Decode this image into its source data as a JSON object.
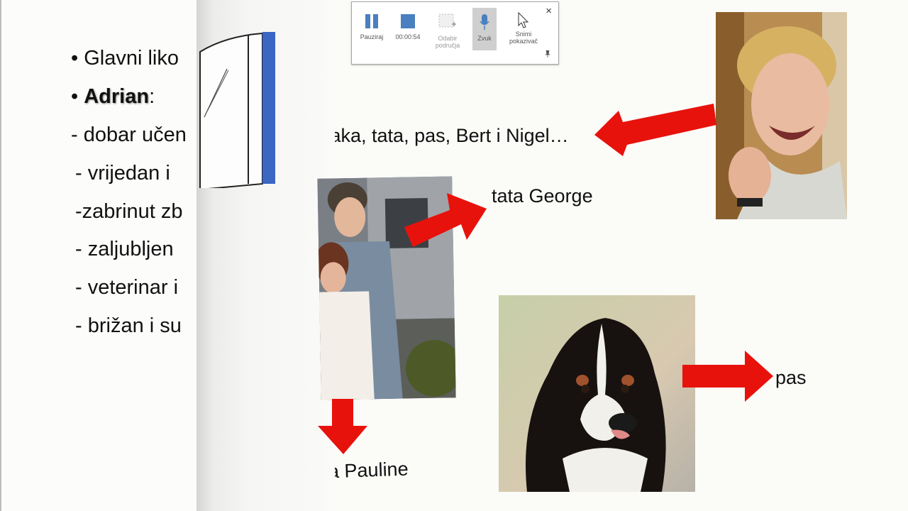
{
  "slide": {
    "bullets": [
      {
        "text": "• Glavni liko"
      },
      {
        "text": "•",
        "bold": "Adrian",
        "suffix": ":"
      },
      {
        "text": "-  dobar učen"
      },
      {
        "text": " - vrijedan i "
      },
      {
        "text": " -zabrinut zb"
      },
      {
        "text": " - zaljubljen "
      },
      {
        "text": " - veterinar i"
      },
      {
        "text": " - brižan i su"
      }
    ],
    "family_text": "ɔaka, tata, pas, Bert i Nigel…",
    "tata_label": "tata George",
    "pauline_label": "na Pauline",
    "pas_label": "pas",
    "arrow_color": "#e8120c"
  },
  "recorder": {
    "buttons": [
      {
        "label": "Pauziraj",
        "icon": "pause-icon"
      },
      {
        "label": "00:00:54",
        "icon": "stop-icon"
      },
      {
        "label": "Odabir područja",
        "icon": "select-area-icon"
      },
      {
        "label": "Zvuk",
        "icon": "microphone-icon"
      },
      {
        "label": "Snimi pokazivač",
        "icon": "pointer-icon"
      }
    ],
    "close": "×",
    "pin": "📌"
  }
}
